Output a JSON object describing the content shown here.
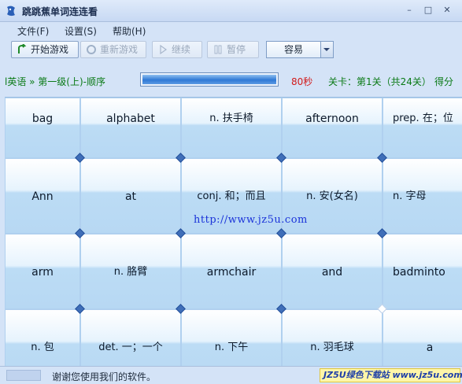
{
  "window": {
    "title": "跳跳蕉单词连连看"
  },
  "menu": [
    "文件(F)",
    "设置(S)",
    "帮助(H)"
  ],
  "toolbar": {
    "start": "开始游戏",
    "restart": "重新游戏",
    "continue": "继续",
    "pause": "暂停",
    "difficulty": "容易"
  },
  "status": {
    "lesson": "l英语 » 第一级(上)-顺序",
    "timer": "80秒",
    "stage": "关卡：第1关（共24关）",
    "score_label": "得分",
    "progress": 1.0
  },
  "board": {
    "rows": [
      [
        "bag",
        "alphabet",
        "n. 扶手椅",
        "afternoon",
        "prep. 在；位"
      ],
      [
        "Ann",
        "at",
        "conj. 和；而且",
        "n. 安(女名)",
        "n. 字母"
      ],
      [
        "arm",
        "n. 胳臂",
        "armchair",
        "and",
        "badminto"
      ],
      [
        "n. 包",
        "det. 一；一个",
        "n. 下午",
        "n. 羽毛球",
        "a"
      ]
    ]
  },
  "watermark": "http://www.jz5u.com",
  "footer": {
    "message": "谢谢您使用我们的软件。",
    "brand": "JZ5U绿色下载站 www.jz5u.com"
  }
}
